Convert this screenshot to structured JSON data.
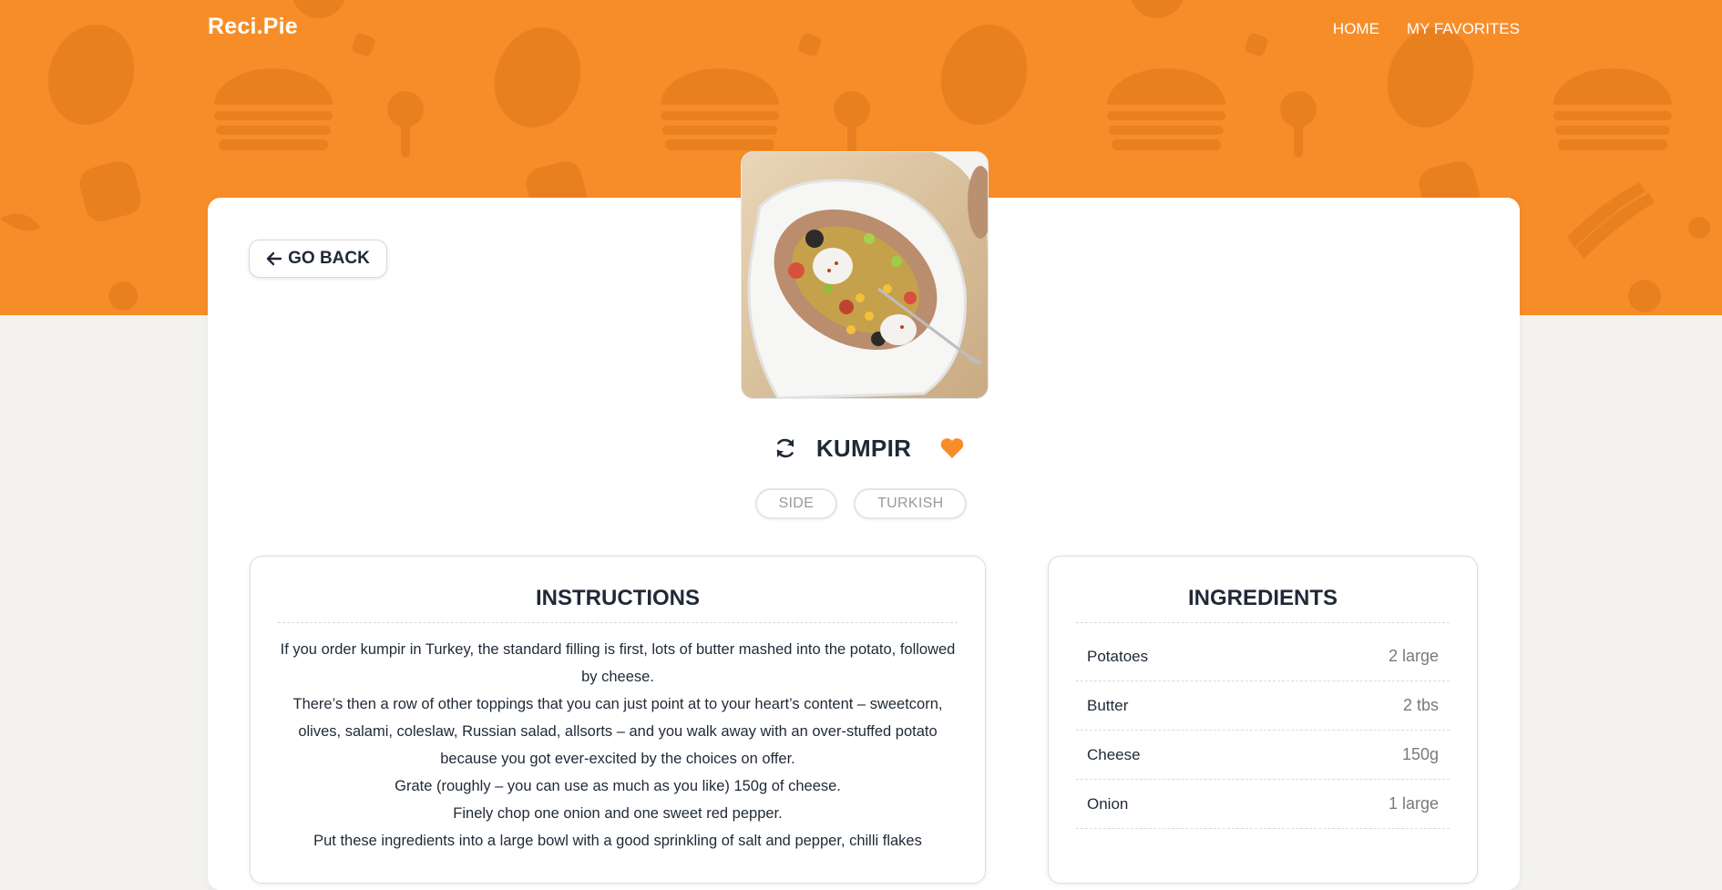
{
  "header": {
    "brand": "Reci.Pie",
    "nav": [
      {
        "label": "HOME"
      },
      {
        "label": "MY FAVORITES"
      }
    ]
  },
  "actions": {
    "back_label": "GO BACK"
  },
  "recipe": {
    "title": "KUMPIR",
    "is_favorite": true,
    "tags": [
      "SIDE",
      "TURKISH"
    ]
  },
  "instructions": {
    "heading": "INSTRUCTIONS",
    "paragraphs": [
      "If you order kumpir in Turkey, the standard filling is first, lots of butter mashed into the potato, followed by cheese.",
      "There’s then a row of other toppings that you can just point at to your heart’s content – sweetcorn, olives, salami, coleslaw, Russian salad, allsorts – and you walk away with an over-stuffed potato because you got ever-excited by the choices on offer.",
      "Grate (roughly – you can use as much as you like) 150g of cheese.",
      "Finely chop one onion and one sweet red pepper.",
      "Put these ingredients into a large bowl with a good sprinkling of salt and pepper, chilli flakes"
    ]
  },
  "ingredients": {
    "heading": "INGREDIENTS",
    "items": [
      {
        "name": "Potatoes",
        "qty": "2 large"
      },
      {
        "name": "Butter",
        "qty": "2 tbs"
      },
      {
        "name": "Cheese",
        "qty": "150g"
      },
      {
        "name": "Onion",
        "qty": "1 large"
      }
    ]
  },
  "colors": {
    "accent": "#f78d28",
    "background": "#f3f2ef",
    "text": "#1f2937"
  },
  "icons": {
    "back": "arrow-left-icon",
    "refresh": "refresh-icon",
    "favorite": "heart-icon"
  }
}
